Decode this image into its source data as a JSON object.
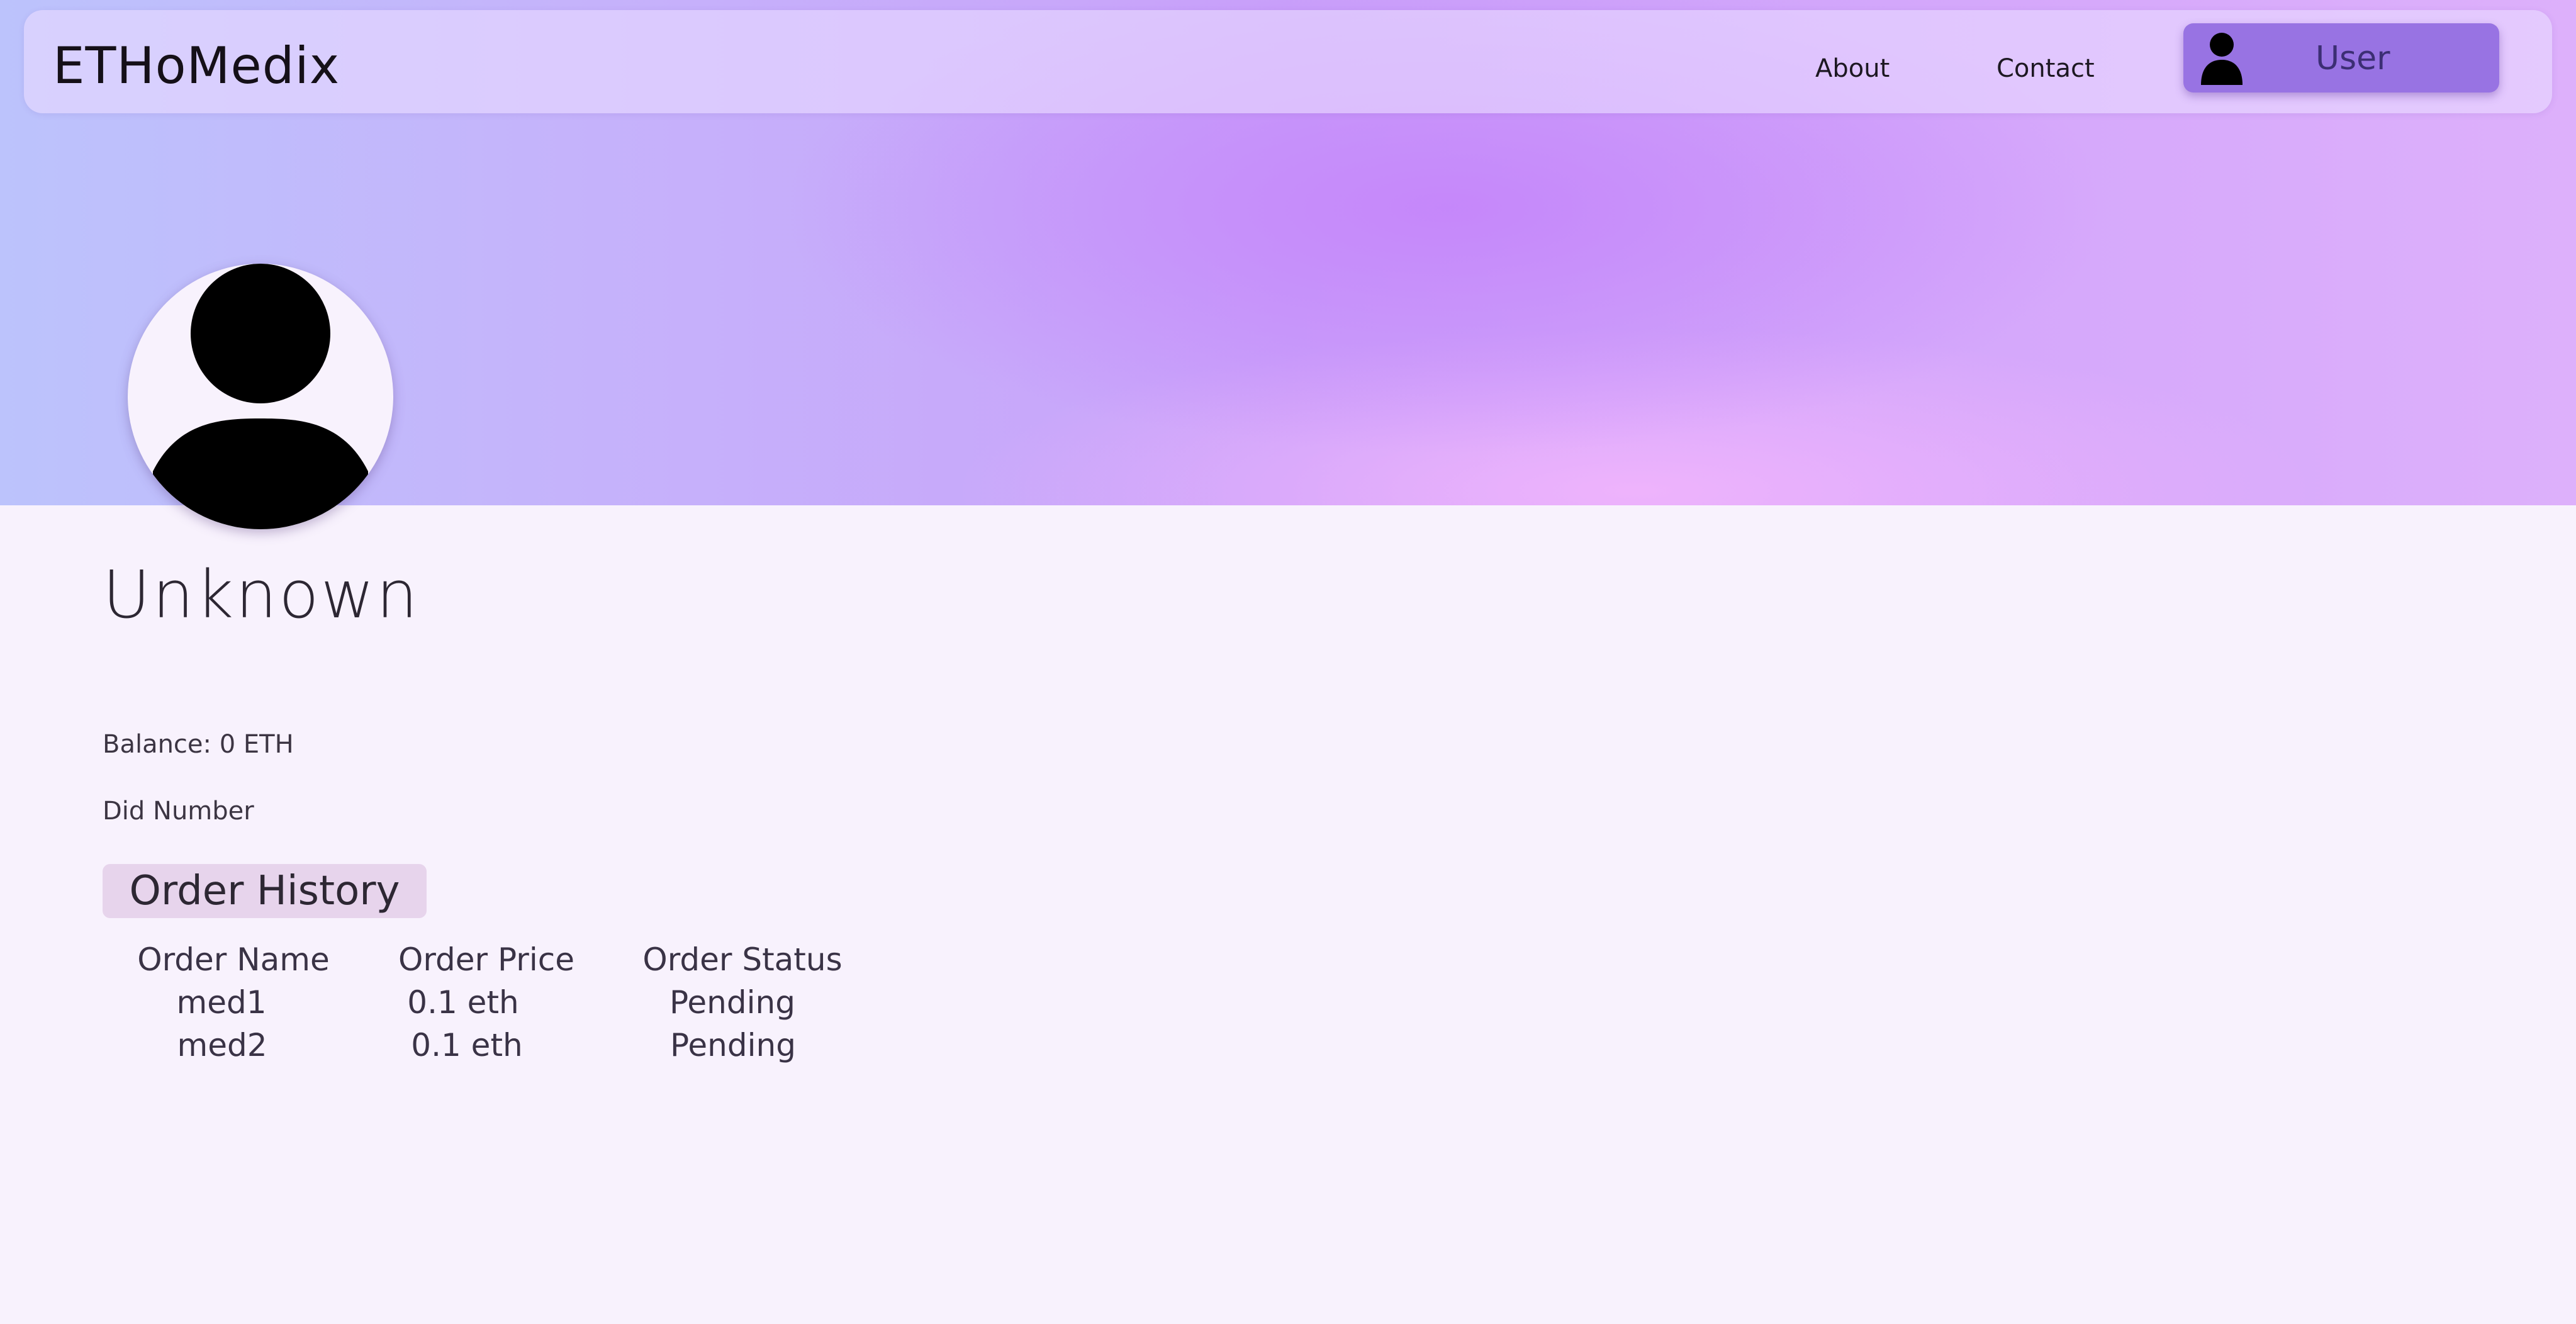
{
  "navbar": {
    "brand": "ETHoMedix",
    "links": [
      "About",
      "Contact"
    ],
    "user_button": {
      "label": "User",
      "icon": "user-icon"
    }
  },
  "profile": {
    "avatar_icon": "user-avatar-icon",
    "name": "Unknown",
    "balance": "Balance: 0 ETH",
    "did": "Did Number"
  },
  "orders": {
    "title": "Order History",
    "columns": [
      "Order Name",
      "Order Price",
      "Order Status"
    ],
    "rows": [
      [
        "med1",
        "0.1 eth",
        "Pending"
      ],
      [
        "med2",
        "0.1 eth",
        "Pending"
      ]
    ]
  },
  "colors": {
    "user_button": "#9873e3",
    "order_history_bg": "#e7d4ec",
    "page_bg": "#f8f2fd"
  }
}
